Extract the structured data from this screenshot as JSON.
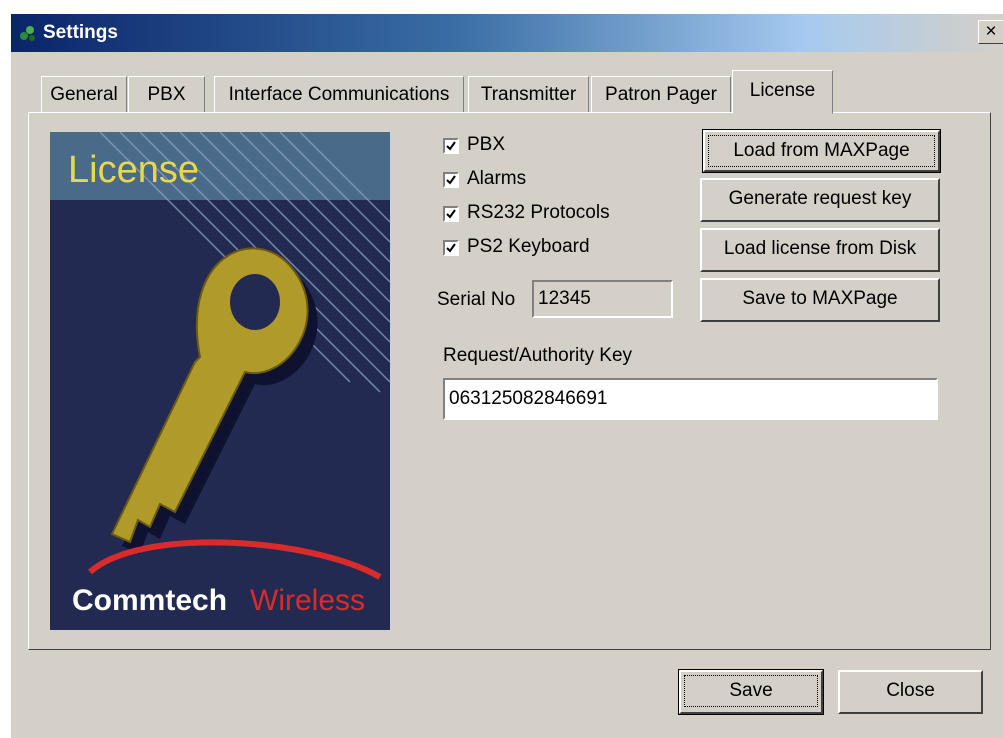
{
  "window": {
    "title": "Settings",
    "close_glyph": "×"
  },
  "tabs": [
    {
      "label": "General"
    },
    {
      "label": "PBX"
    },
    {
      "label": "Interface Communications"
    },
    {
      "label": "Transmitter"
    },
    {
      "label": "Patron Pager"
    },
    {
      "label": "License",
      "active": true
    }
  ],
  "license_image": {
    "heading": "License",
    "brand_first": "Commtech",
    "brand_second": "Wireless",
    "icon": "key-icon"
  },
  "checkboxes": [
    {
      "label": "PBX",
      "checked": true
    },
    {
      "label": "Alarms",
      "checked": true
    },
    {
      "label": "RS232 Protocols",
      "checked": true
    },
    {
      "label": "PS2 Keyboard",
      "checked": true
    }
  ],
  "serial": {
    "label": "Serial No",
    "value": "12345"
  },
  "request_key": {
    "label": "Request/Authority Key",
    "value": "063125082846691"
  },
  "buttons": {
    "load_from_maxpage": "Load from MAXPage",
    "generate_request_key": "Generate request key",
    "load_license_from_disk": "Load license from Disk",
    "save_to_maxpage": "Save to MAXPage"
  },
  "footer": {
    "save": "Save",
    "close": "Close"
  },
  "colors": {
    "titlebar": "#0a246a",
    "dialog": "#d4d0c8",
    "image_bg": "#232a52",
    "key_gold": "#b09a2a",
    "brand_red": "#d92b2b"
  }
}
